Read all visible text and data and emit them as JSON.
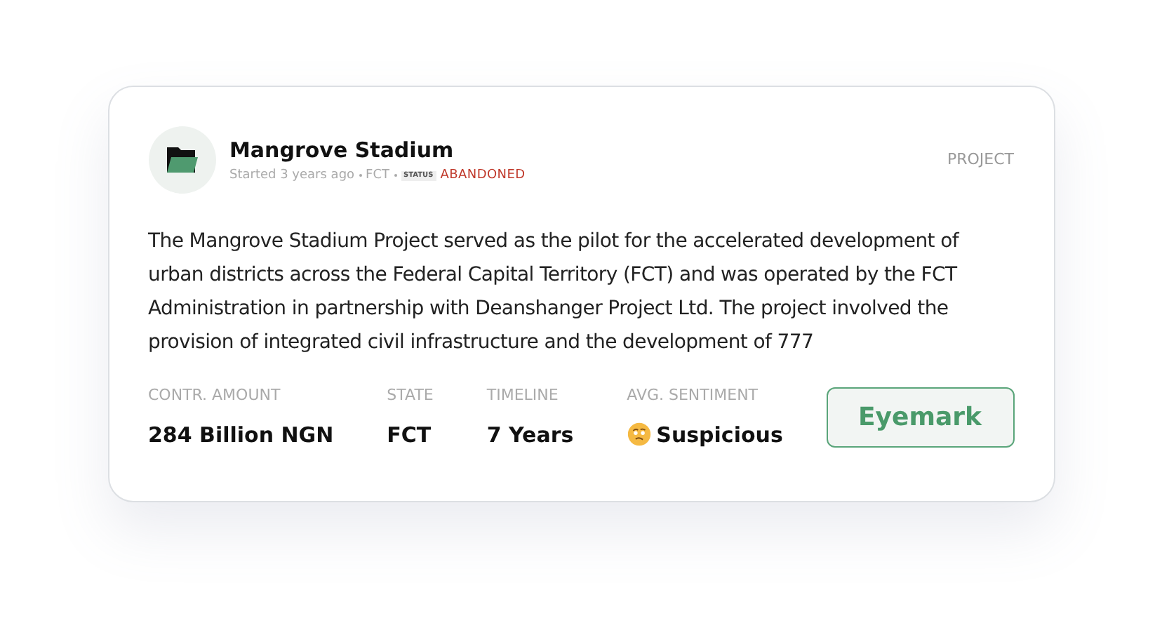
{
  "project": {
    "title": "Mangrove Stadium",
    "started": "Started 3 years ago",
    "location": "FCT",
    "status_label": "STATUS",
    "status": "ABANDONED",
    "type_label": "PROJECT"
  },
  "description": "The Mangrove Stadium Project served as the pilot for the accelerated development of urban districts across the Federal Capital Territory (FCT) and was operated by the FCT Administration in partnership with Deanshanger Project Ltd. The project involved the provision of integrated civil infrastructure and the development of 777",
  "stats": [
    {
      "label": "CONTR. AMOUNT",
      "value": "284 Billion NGN",
      "kind": "text"
    },
    {
      "label": "STATE",
      "value": "FCT",
      "kind": "text"
    },
    {
      "label": "TIMELINE",
      "value": "7 Years",
      "kind": "text"
    },
    {
      "label": "AVG. SENTIMENT",
      "value": "Suspicious",
      "kind": "sentiment"
    }
  ],
  "button": "Eyemark"
}
